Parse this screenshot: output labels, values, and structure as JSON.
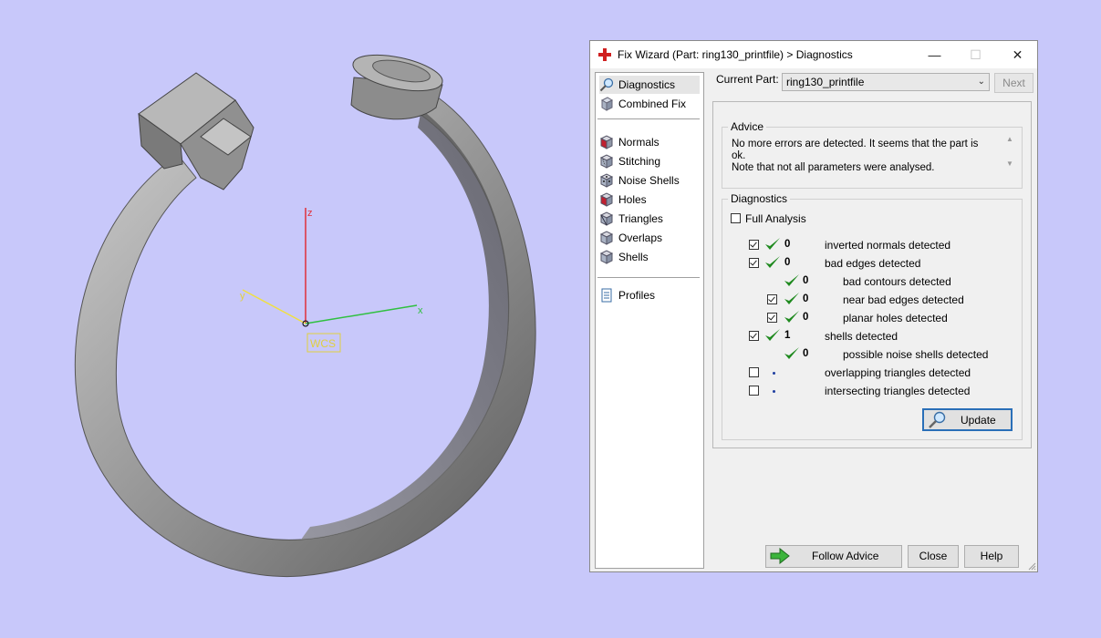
{
  "viewport": {
    "axis_labels": {
      "z": "z",
      "y": "y",
      "x": "x"
    },
    "wcs_label": "WCS"
  },
  "dialog": {
    "title": "Fix Wizard (Part: ring130_printfile) > Diagnostics",
    "window_controls": {
      "minimize": "—",
      "maximize": "☐",
      "close": "✕"
    }
  },
  "nav": {
    "top_items": [
      {
        "label": "Diagnostics",
        "icon": "magnifier-icon"
      },
      {
        "label": "Combined Fix",
        "icon": "cube-icon"
      }
    ],
    "fix_items": [
      {
        "label": "Normals",
        "icon": "normals-cube-icon"
      },
      {
        "label": "Stitching",
        "icon": "stitching-cube-icon"
      },
      {
        "label": "Noise Shells",
        "icon": "noise-shells-icon"
      },
      {
        "label": "Holes",
        "icon": "holes-cube-icon"
      },
      {
        "label": "Triangles",
        "icon": "triangles-cube-icon"
      },
      {
        "label": "Overlaps",
        "icon": "overlaps-cube-icon"
      },
      {
        "label": "Shells",
        "icon": "shells-cube-icon"
      }
    ],
    "profiles_label": "Profiles"
  },
  "current_part": {
    "label": "Current Part:",
    "value": "ring130_printfile",
    "next_label": "Next"
  },
  "advice": {
    "group_label": "Advice",
    "text": "No more errors are detected. It seems that the part is ok.\nNote that not all parameters were analysed."
  },
  "diagnostics": {
    "group_label": "Diagnostics",
    "full_analysis_label": "Full Analysis",
    "rows": [
      {
        "checkbox": "checked",
        "status": "ok",
        "count": "0",
        "label": "inverted normals detected"
      },
      {
        "checkbox": "checked",
        "status": "ok",
        "count": "0",
        "label": "bad edges detected"
      },
      {
        "checkbox": "none",
        "status": "ok",
        "count": "0",
        "label": "bad contours detected"
      },
      {
        "checkbox": "checked",
        "status": "ok",
        "count": "0",
        "label": "near bad edges detected"
      },
      {
        "checkbox": "checked",
        "status": "ok",
        "count": "0",
        "label": "planar holes detected"
      },
      {
        "checkbox": "checked",
        "status": "ok",
        "count": "1",
        "label": "shells detected"
      },
      {
        "checkbox": "none",
        "status": "ok",
        "count": "0",
        "label": "possible noise shells detected"
      },
      {
        "checkbox": "unchecked",
        "status": "pending",
        "count": "",
        "label": "overlapping triangles detected"
      },
      {
        "checkbox": "unchecked",
        "status": "pending",
        "count": "",
        "label": "intersecting triangles detected"
      }
    ],
    "update_label": "Update"
  },
  "buttons": {
    "follow_advice": "Follow Advice",
    "close": "Close",
    "help": "Help"
  },
  "colors": {
    "background": "#c8c8fa",
    "ring": "#9a9a9a",
    "z_axis": "#e0303a",
    "x_axis": "#30c040",
    "y_axis": "#f0e040",
    "check_green": "#1f8a1f",
    "focus_blue": "#2a6fb8"
  }
}
